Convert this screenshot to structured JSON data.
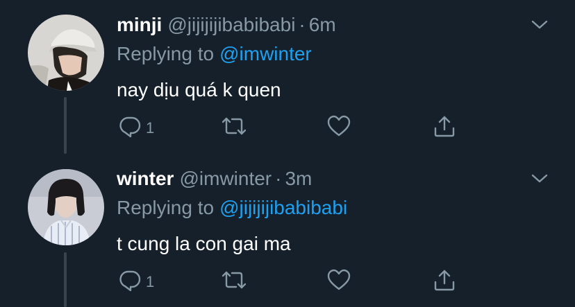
{
  "tweets": [
    {
      "name": "minji",
      "handle": "@jijijijibabibabi",
      "separator": "·",
      "time": "6m",
      "reply_prefix": "Replying to",
      "reply_to": "@imwinter",
      "text": "nay dịu quá k quen",
      "reply_count": "1",
      "avatar": "user-avatar-photo"
    },
    {
      "name": "winter",
      "handle": "@imwinter",
      "separator": "·",
      "time": "3m",
      "reply_prefix": "Replying to",
      "reply_to": "@jijijijibabibabi",
      "text": "t cung la con gai ma",
      "reply_count": "1",
      "avatar": "user-avatar-photo"
    }
  ],
  "colors": {
    "background": "#15202b",
    "primary_text": "#ffffff",
    "secondary_text": "#8899a6",
    "link": "#1da1f2",
    "thread_line": "#38444d"
  },
  "icons": [
    "reply-icon",
    "retweet-icon",
    "like-icon",
    "share-icon",
    "chevron-down-icon"
  ]
}
